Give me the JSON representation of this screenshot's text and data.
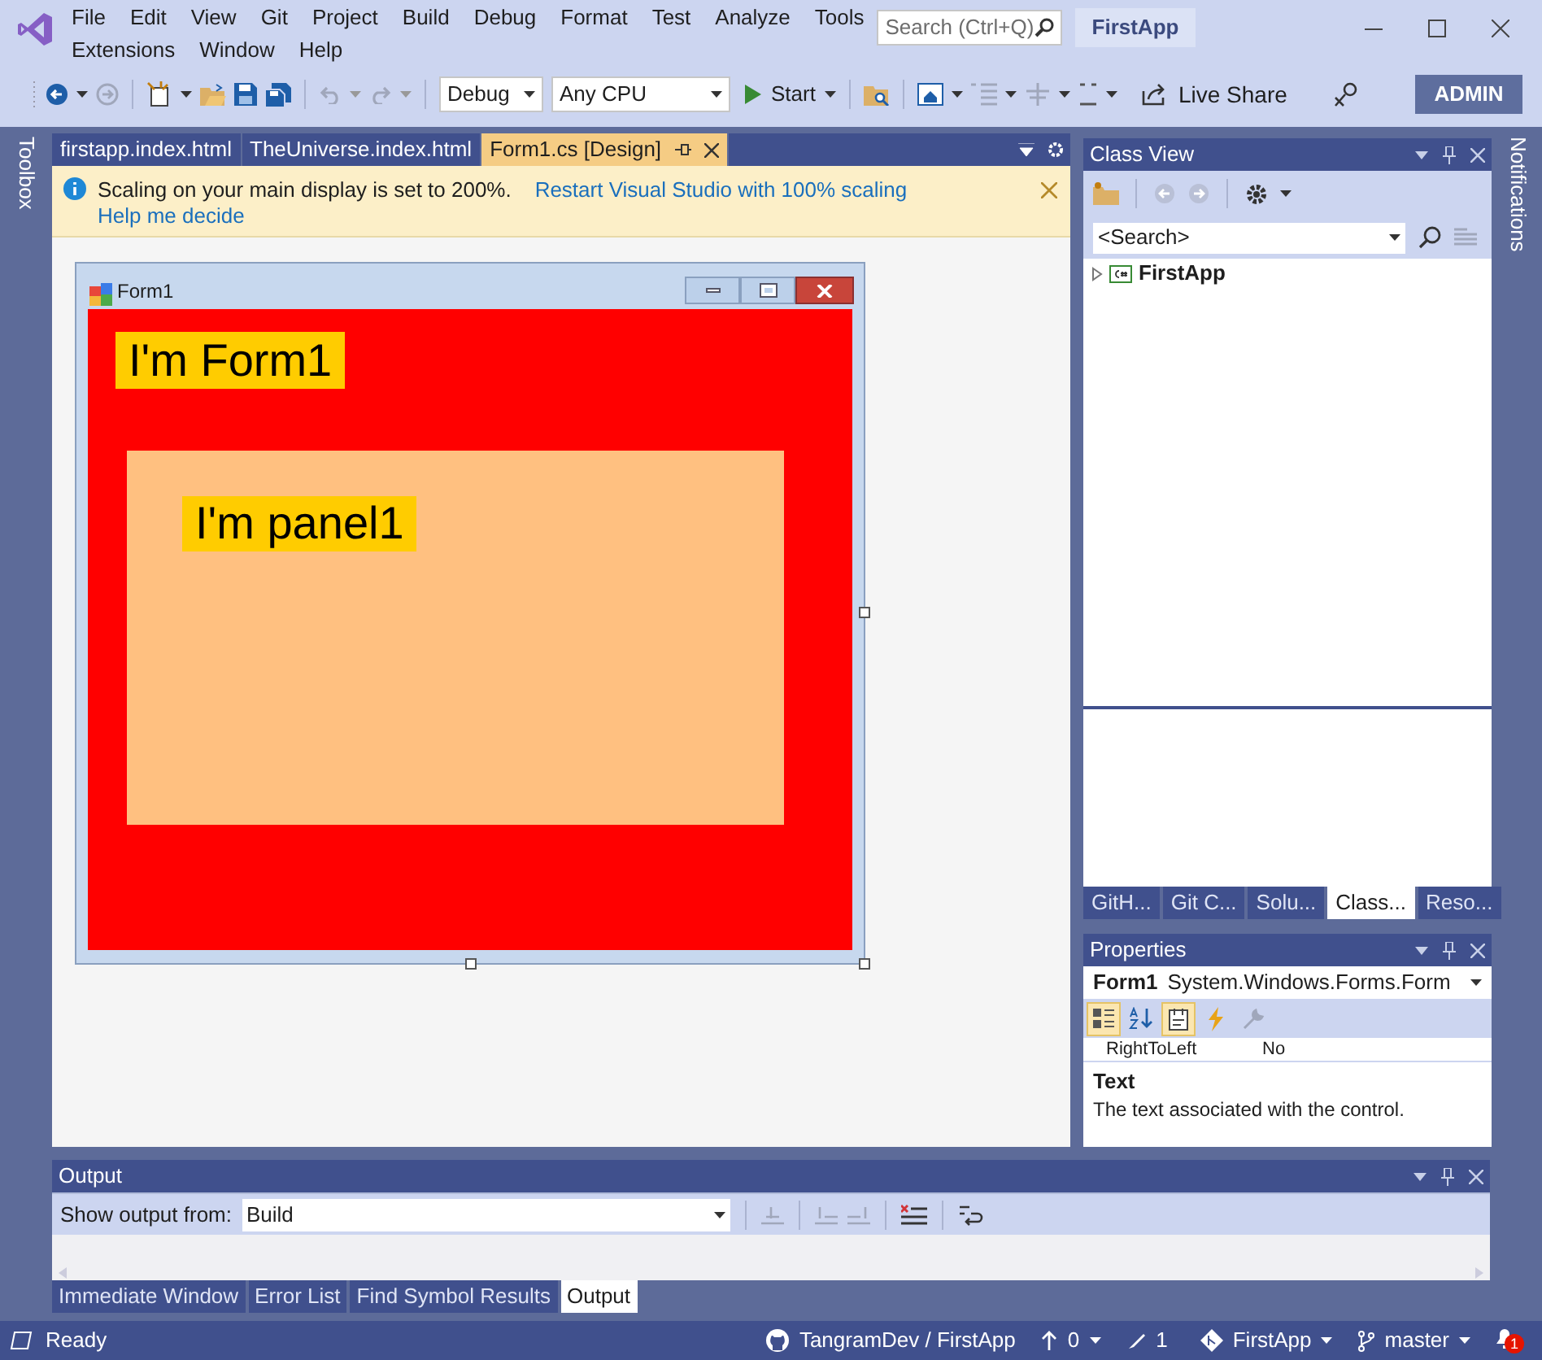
{
  "menu_rows": [
    {
      "items": [
        "File",
        "Edit",
        "View",
        "Git",
        "Project",
        "Build",
        "Debug",
        "Format",
        "Test",
        "Analyze",
        "Tools"
      ]
    },
    {
      "items": [
        "Extensions",
        "Window",
        "Help"
      ]
    }
  ],
  "search": {
    "placeholder": "Search (Ctrl+Q)"
  },
  "solution_name": "FirstApp",
  "toolbar": {
    "configuration": "Debug",
    "platform": "Any CPU",
    "start": "Start",
    "live_share": "Live Share",
    "account": "ADMIN"
  },
  "document_tabs": [
    {
      "label": "firstapp.index.html",
      "selected": false
    },
    {
      "label": "TheUniverse.index.html",
      "selected": false
    },
    {
      "label": "Form1.cs [Design]",
      "selected": true
    }
  ],
  "info_bar": {
    "message": "Scaling on your main display is set to 200%.",
    "links": [
      "Restart Visual Studio with 100% scaling",
      "Help me decide"
    ]
  },
  "designer": {
    "form_title": "Form1",
    "form_label": "I'm Form1",
    "panel_label": "I'm panel1"
  },
  "side_strips": {
    "left": "Toolbox",
    "right": "Notifications"
  },
  "class_view": {
    "title": "Class View",
    "search_placeholder": "<Search>",
    "tree": [
      {
        "label": "FirstApp",
        "expanded": false
      }
    ]
  },
  "panel_tabs": [
    {
      "label": "GitH...",
      "selected": false
    },
    {
      "label": "Git C...",
      "selected": false
    },
    {
      "label": "Solu...",
      "selected": false
    },
    {
      "label": "Class...",
      "selected": true
    },
    {
      "label": "Reso...",
      "selected": false
    }
  ],
  "properties": {
    "title": "Properties",
    "object_name": "Form1",
    "object_type": "System.Windows.Forms.Form",
    "toolbar": [
      {
        "kind": "categorized",
        "selected": true
      },
      {
        "kind": "alphabetical",
        "selected": false
      },
      {
        "kind": "properties",
        "selected": true
      },
      {
        "kind": "events",
        "selected": false
      },
      {
        "kind": "pages",
        "selected": false
      }
    ],
    "row": {
      "name": "RightToLeft",
      "value": "No"
    },
    "description_title": "Text",
    "description": "The text associated with the control."
  },
  "output": {
    "title": "Output",
    "show_from_label": "Show output from:",
    "source": "Build"
  },
  "bottom_tabs": [
    {
      "label": "Immediate Window",
      "selected": false
    },
    {
      "label": "Error List",
      "selected": false
    },
    {
      "label": "Find Symbol Results",
      "selected": false
    },
    {
      "label": "Output",
      "selected": true
    }
  ],
  "status_bar": {
    "state": "Ready",
    "repository": "TangramDev / FirstApp",
    "pushes": "0",
    "changes": "1",
    "repo_name": "FirstApp",
    "branch": "master",
    "notifications": "1"
  }
}
